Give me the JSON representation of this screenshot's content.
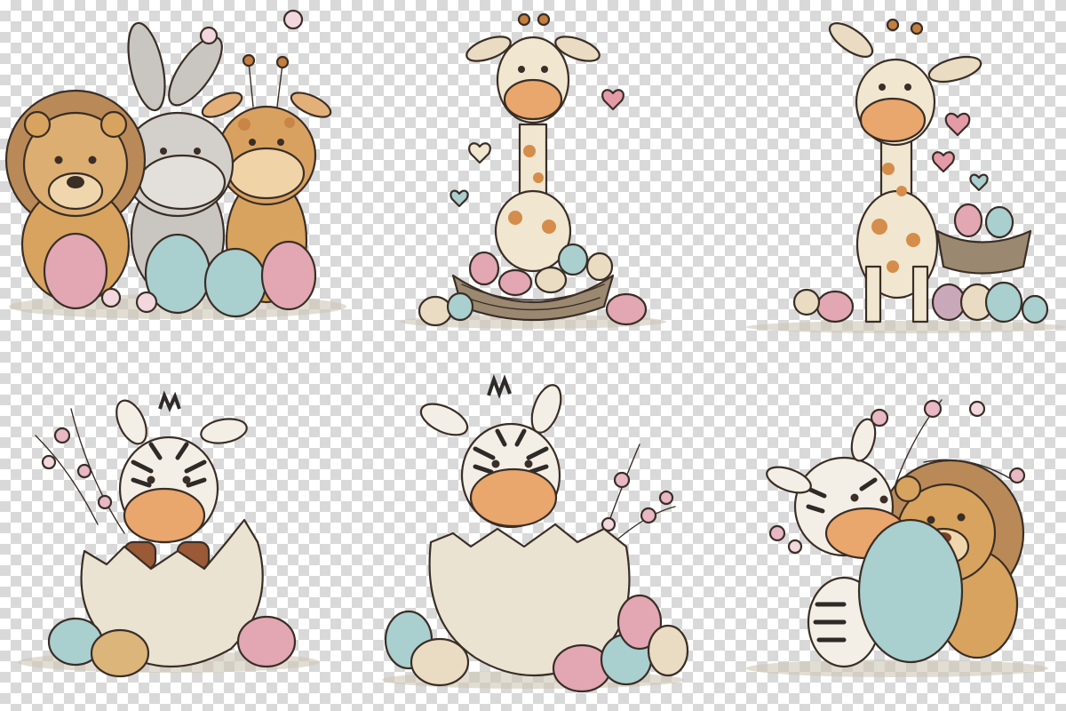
{
  "palette": {
    "egg_pink": "#e2a7b3",
    "egg_blue": "#a9cfcf",
    "egg_cream": "#eadcc2",
    "egg_tan": "#dcb57a",
    "lion_fur": "#d8a35e",
    "lion_mane": "#b98a58",
    "giraffe_fur": "#f1e6cf",
    "giraffe_spot": "#d48d4a",
    "snout": "#e9a66d",
    "zebra_white": "#f4efe6",
    "zebra_stripe": "#2e2a28",
    "bunny_grey": "#c9c6c1",
    "shell": "#ebe3d1",
    "nest": "#9b8870",
    "blossom": "#e8b8c4",
    "heart": "#e59aa8"
  },
  "illustrations": [
    {
      "name": "lion-bunny-giraffe-eggs",
      "subjects": [
        "lion",
        "bunny",
        "giraffe"
      ],
      "props": [
        "easter-eggs",
        "blossoms"
      ]
    },
    {
      "name": "giraffe-in-nest-hearts",
      "subjects": [
        "giraffe"
      ],
      "props": [
        "nest",
        "easter-eggs",
        "hearts"
      ]
    },
    {
      "name": "giraffe-standing-nest-eggs",
      "subjects": [
        "giraffe"
      ],
      "props": [
        "nest",
        "easter-eggs",
        "hearts"
      ]
    },
    {
      "name": "zebra-in-cracked-egg",
      "subjects": [
        "zebra"
      ],
      "props": [
        "cracked-eggshell",
        "easter-eggs",
        "blossom-branch"
      ]
    },
    {
      "name": "zebra-in-eggshell-eggs",
      "subjects": [
        "zebra"
      ],
      "props": [
        "cracked-eggshell",
        "easter-eggs",
        "blossom-branch"
      ]
    },
    {
      "name": "zebra-lion-hugging-egg",
      "subjects": [
        "zebra",
        "lion"
      ],
      "props": [
        "giant-egg",
        "blossom-branch"
      ]
    }
  ]
}
